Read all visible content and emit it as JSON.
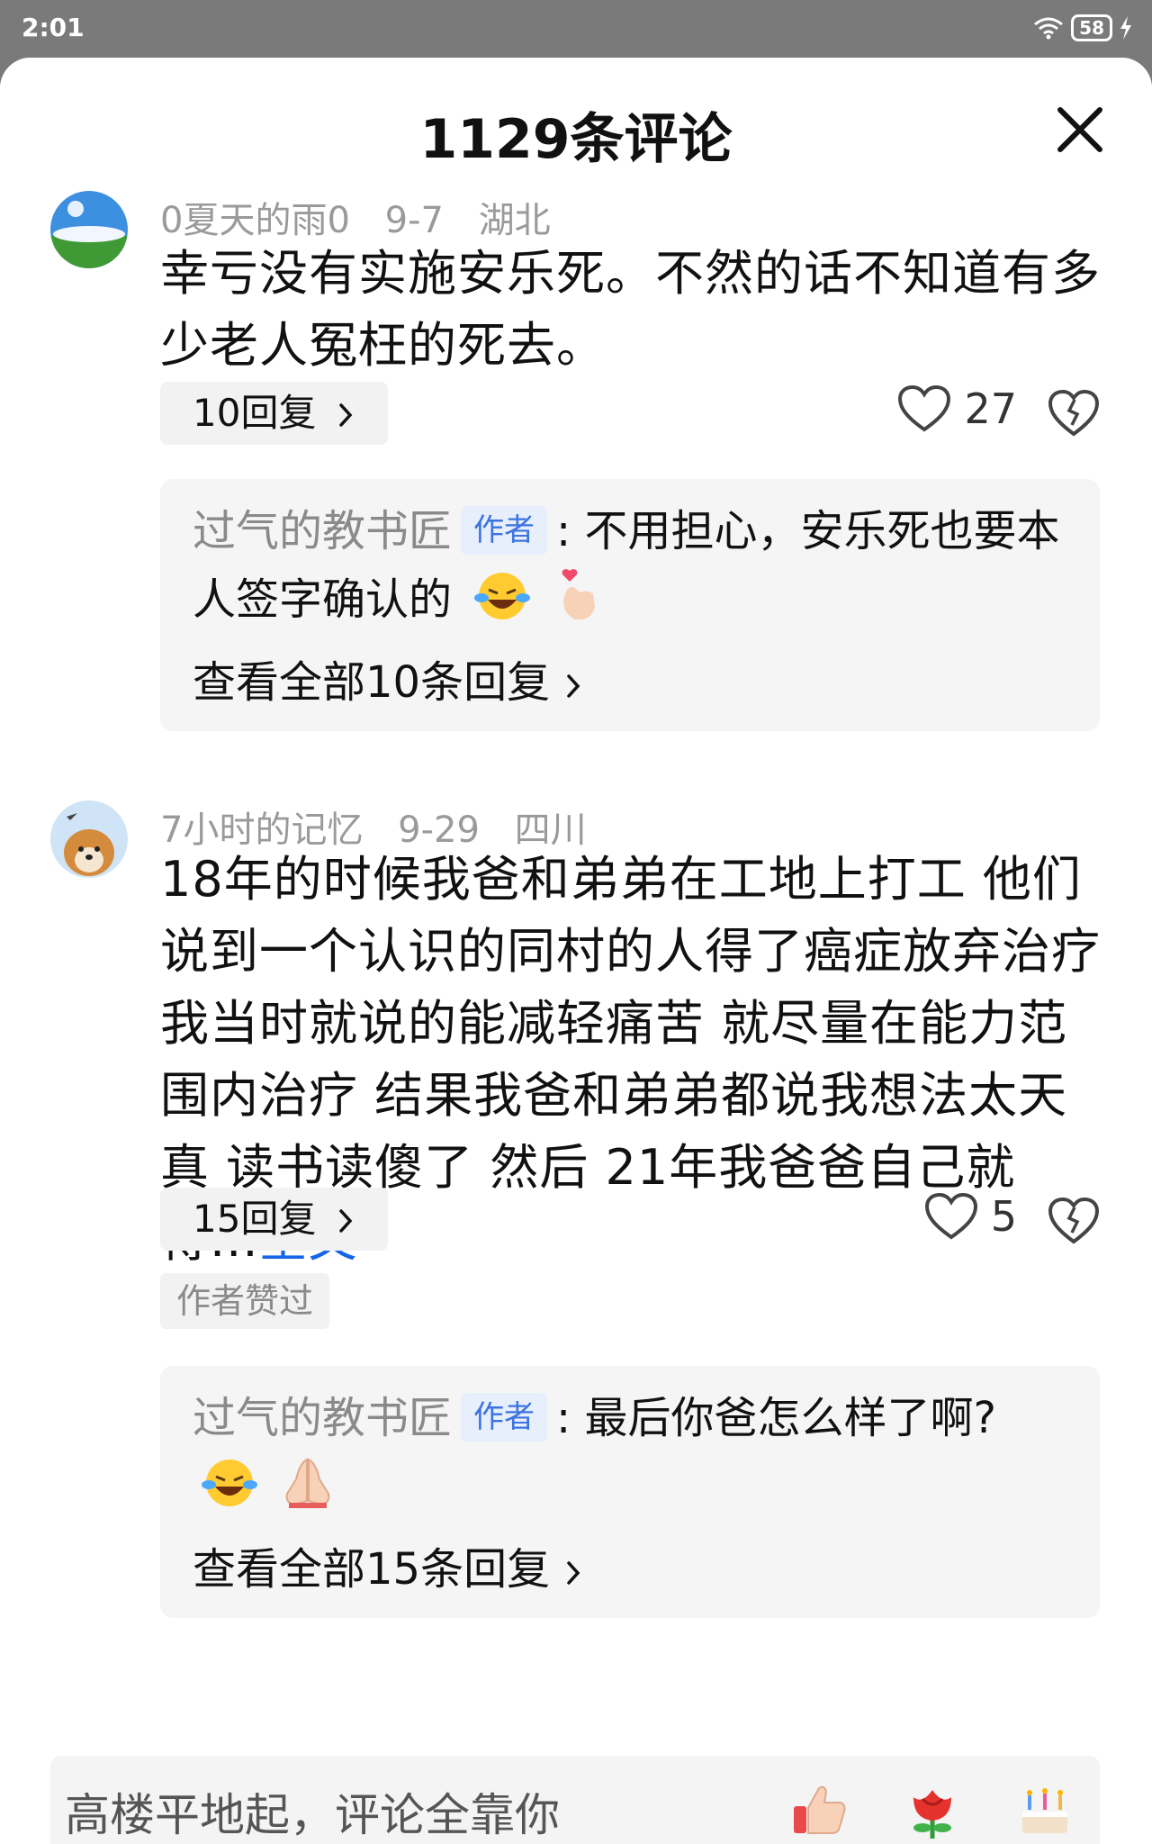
{
  "status_bar": {
    "time": "2:01",
    "battery": "58"
  },
  "sheet": {
    "title": "1129条评论"
  },
  "comments": [
    {
      "username": "0夏天的雨0",
      "date": "9-7",
      "location": "湖北",
      "text": "幸亏没有实施安乐死。不然的话不知道有多少老人冤枉的死去。",
      "replies_label": "10回复",
      "likes": "27",
      "author_reply": {
        "user": "过气的教书匠",
        "tag": "作者",
        "text": "不用担心，安乐死也要本人签字确认的",
        "view_all": "查看全部10条回复"
      }
    },
    {
      "username": "7小时的记忆",
      "date": "9-29",
      "location": "四川",
      "text": "18年的时候我爸和弟弟在工地上打工 他们说到一个认识的同村的人得了癌症放弃治疗 我当时就说的能减轻痛苦 就尽量在能力范围内治疗 结果我爸和弟弟都说我想法太天真 读书读傻了 然后 21年我爸爸自己就得...",
      "full_text_link": "全文",
      "replies_label": "15回复",
      "likes": "5",
      "author_liked": "作者赞过",
      "author_reply": {
        "user": "过气的教书匠",
        "tag": "作者",
        "text": "最后你爸怎么样了啊?",
        "view_all": "查看全部15条回复"
      }
    }
  ],
  "input": {
    "placeholder": "高楼平地起，评论全靠你"
  },
  "icons": {
    "close": "close-icon",
    "like": "heart-icon",
    "dislike": "broken-heart-icon",
    "quick_reactions": [
      "thumbs-up-icon",
      "rose-icon",
      "cake-icon"
    ]
  }
}
